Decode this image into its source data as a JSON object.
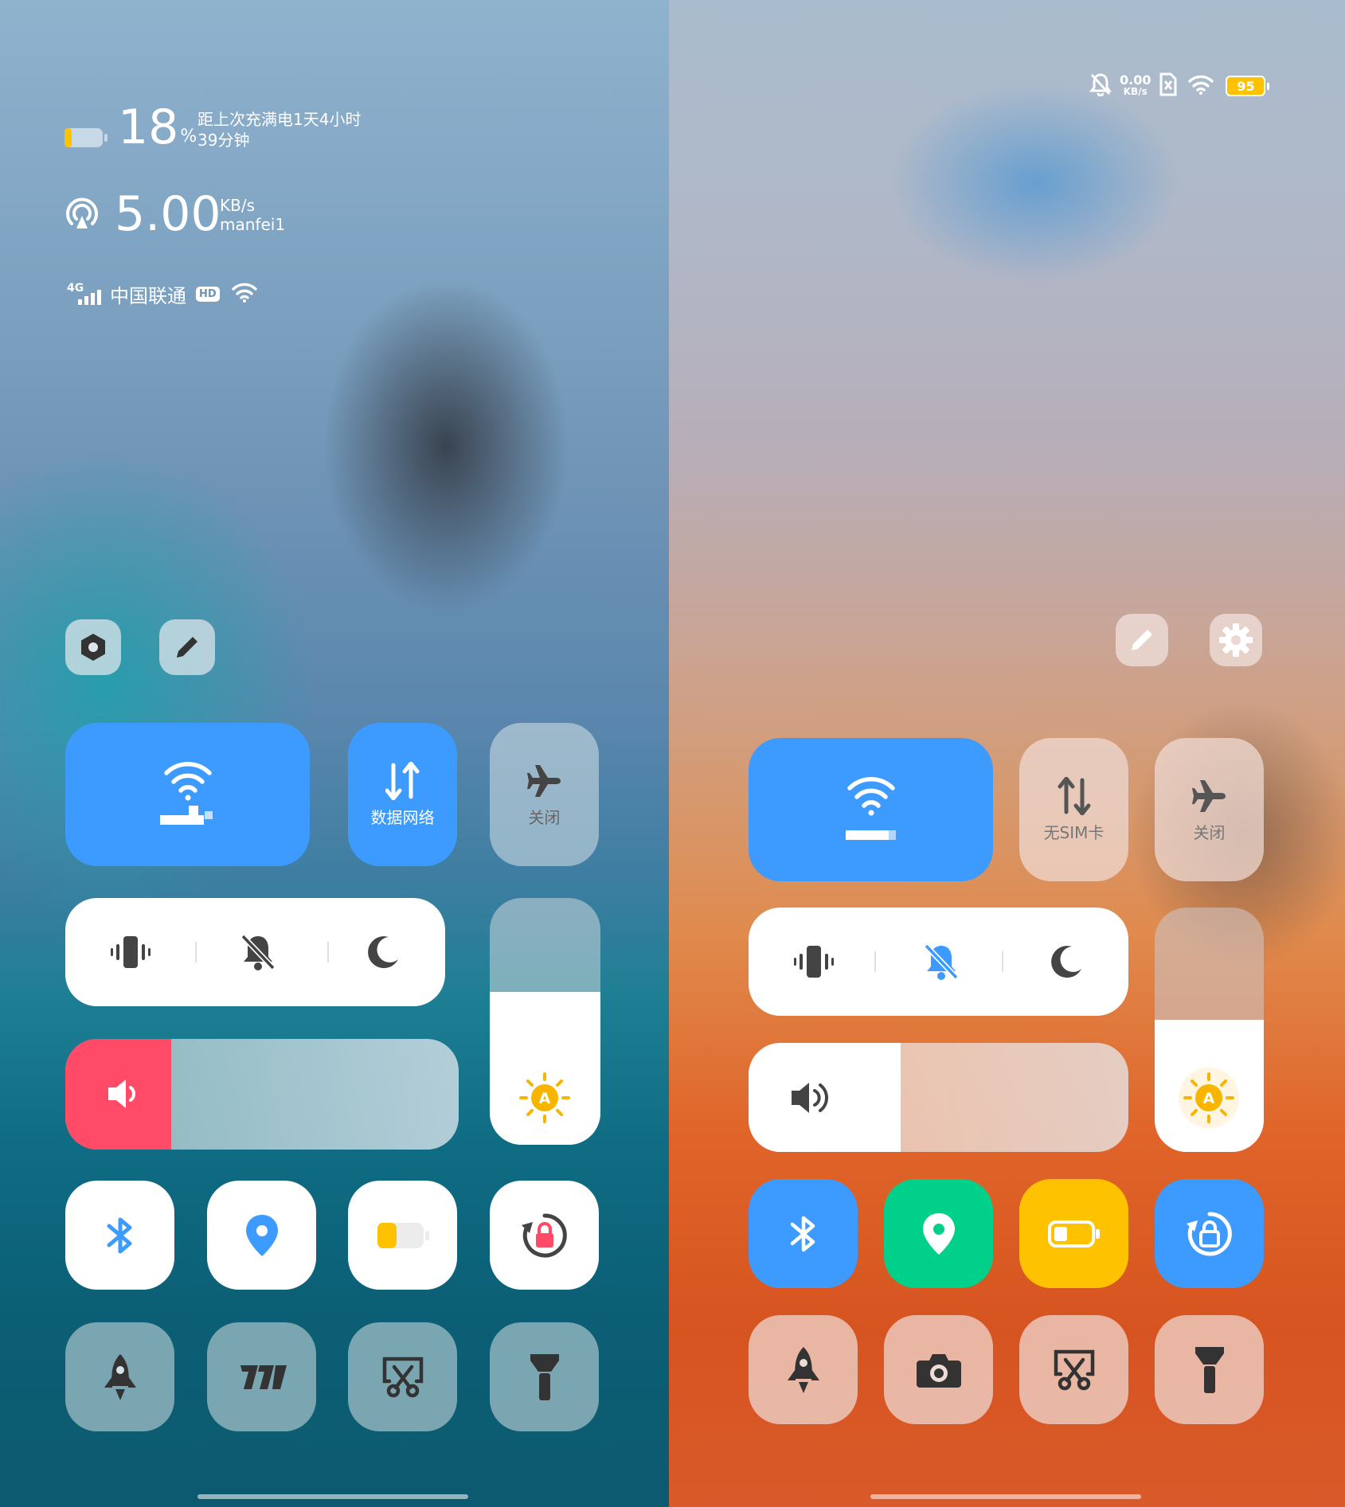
{
  "left": {
    "battery": {
      "percent": "18",
      "percent_unit": "%",
      "line1": "距上次充满电1天4小时",
      "line2": "39分钟",
      "level": 0.18
    },
    "speed": {
      "value": "5.00",
      "unit": "KB/s",
      "network_name": "manfei1"
    },
    "carrier": {
      "network_type": "4G",
      "name": "中国联通",
      "hd_badge": "HD"
    },
    "tiles": {
      "mobile_data_label": "数据网络",
      "airplane_label": "关闭"
    },
    "brightness_level": 0.62,
    "volume_level": 0.27
  },
  "right": {
    "status": {
      "speed_value": "0.00",
      "speed_unit": "KB/s",
      "battery_text": "95"
    },
    "tiles": {
      "sim_label": "无SIM卡",
      "airplane_label": "关闭"
    },
    "brightness_level": 0.54,
    "volume_level": 0.4
  },
  "colors": {
    "active_blue": "#3d9bff",
    "volume_red": "#ff4a68",
    "location_green": "#00d08a",
    "battery_yellow": "#ffc200",
    "brightness_sun": "#f7b500"
  }
}
